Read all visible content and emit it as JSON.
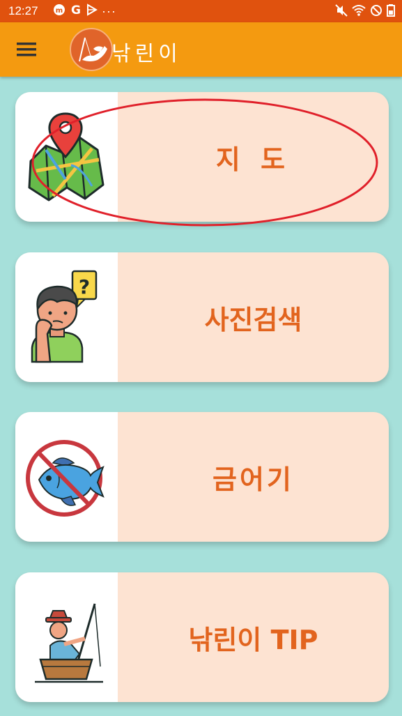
{
  "status_bar": {
    "time": "12:27",
    "left_icons": [
      "m-badge-icon",
      "google-icon",
      "play-icon",
      "more-dots-icon"
    ],
    "right_icons": [
      "mute-icon",
      "wifi-icon",
      "block-icon",
      "battery-icon"
    ],
    "dots": "···"
  },
  "app_bar": {
    "title": "낚린이",
    "menu_icon": "hamburger-menu-icon",
    "logo": "fishing-logo"
  },
  "menu": [
    {
      "label": "지 도",
      "icon": "map-pin-icon"
    },
    {
      "label": "사진검색",
      "icon": "thinking-person-icon"
    },
    {
      "label": "금어기",
      "icon": "no-fish-icon"
    },
    {
      "label": "낚린이 TIP",
      "icon": "fisherman-boat-icon"
    }
  ],
  "colors": {
    "status_bar": "#e0520e",
    "app_bar": "#f49a10",
    "background": "#a6e0da",
    "card": "#fde3d2",
    "label": "#e2641e",
    "highlight": "#e0202a"
  }
}
